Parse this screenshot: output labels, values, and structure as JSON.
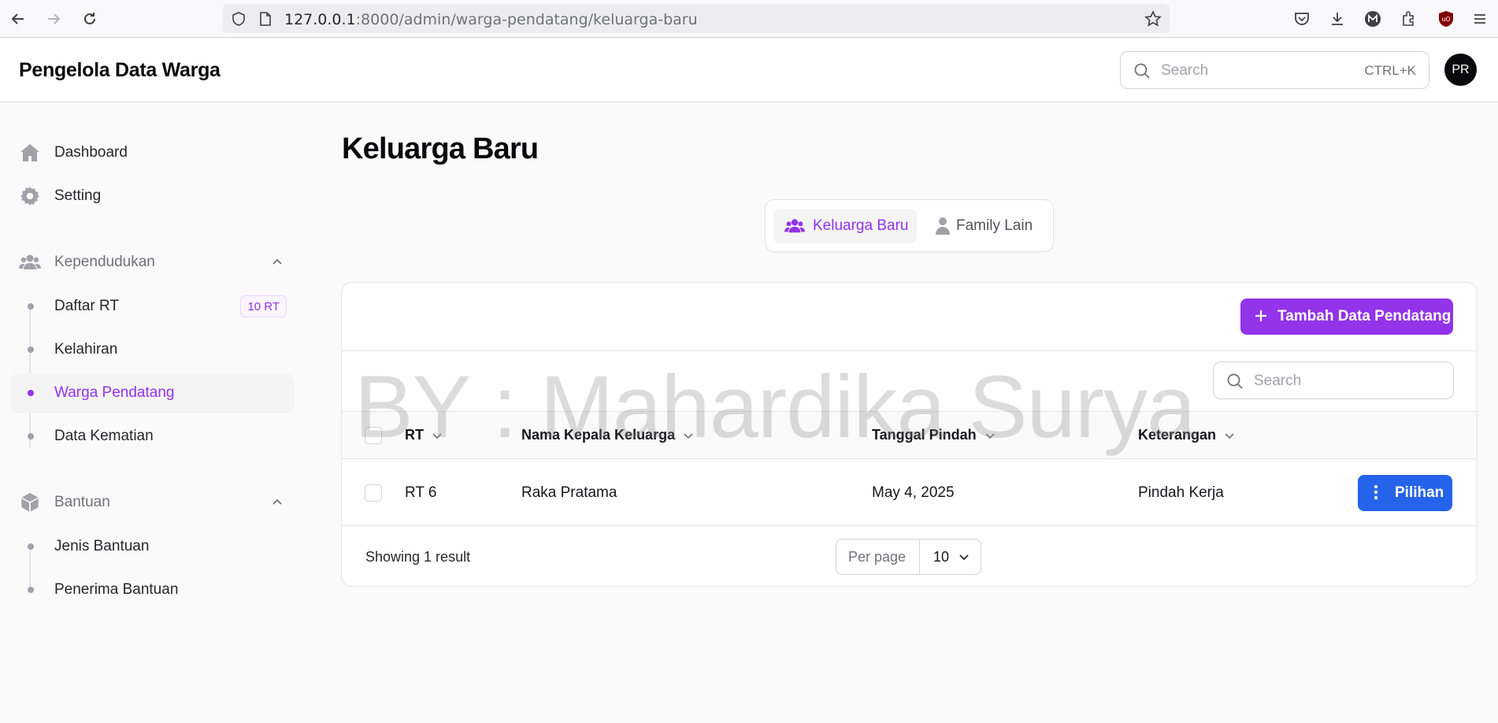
{
  "browser": {
    "url_host": "127.0.0.1",
    "url_rest": ":8000/admin/warga-pendatang/keluarga-baru"
  },
  "header": {
    "brand": "Pengelola Data Warga",
    "search_placeholder": "Search",
    "search_shortcut": "CTRL+K",
    "avatar_initials": "PR"
  },
  "sidebar": {
    "items": [
      {
        "label": "Dashboard",
        "icon": "home-icon"
      },
      {
        "label": "Setting",
        "icon": "gear-icon"
      }
    ],
    "groups": [
      {
        "label": "Kependudukan",
        "icon": "users-icon",
        "items": [
          {
            "label": "Daftar RT",
            "badge": "10 RT"
          },
          {
            "label": "Kelahiran"
          },
          {
            "label": "Warga Pendatang",
            "active": true
          },
          {
            "label": "Data Kematian"
          }
        ]
      },
      {
        "label": "Bantuan",
        "icon": "cube-icon",
        "items": [
          {
            "label": "Jenis Bantuan"
          },
          {
            "label": "Penerima Bantuan"
          }
        ]
      }
    ]
  },
  "main": {
    "title": "Keluarga Baru",
    "tabs": [
      {
        "label": "Keluarga Baru",
        "icon": "users-icon",
        "active": true
      },
      {
        "label": "Family Lain",
        "icon": "user-icon",
        "active": false
      }
    ],
    "add_button": "Tambah Data Pendatang",
    "table_search_placeholder": "Search",
    "columns": [
      "RT",
      "Nama Kepala Keluarga",
      "Tanggal Pindah",
      "Keterangan"
    ],
    "rows": [
      {
        "rt": "RT 6",
        "nama": "Raka Pratama",
        "tanggal": "May 4, 2025",
        "keterangan": "Pindah Kerja",
        "action": "Pilihan"
      }
    ],
    "showing": "Showing 1 result",
    "per_page_label": "Per page",
    "per_page_value": "10"
  },
  "watermark": "BY : Mahardika Surya",
  "colors": {
    "accent": "#9333ea",
    "action": "#2563eb"
  }
}
